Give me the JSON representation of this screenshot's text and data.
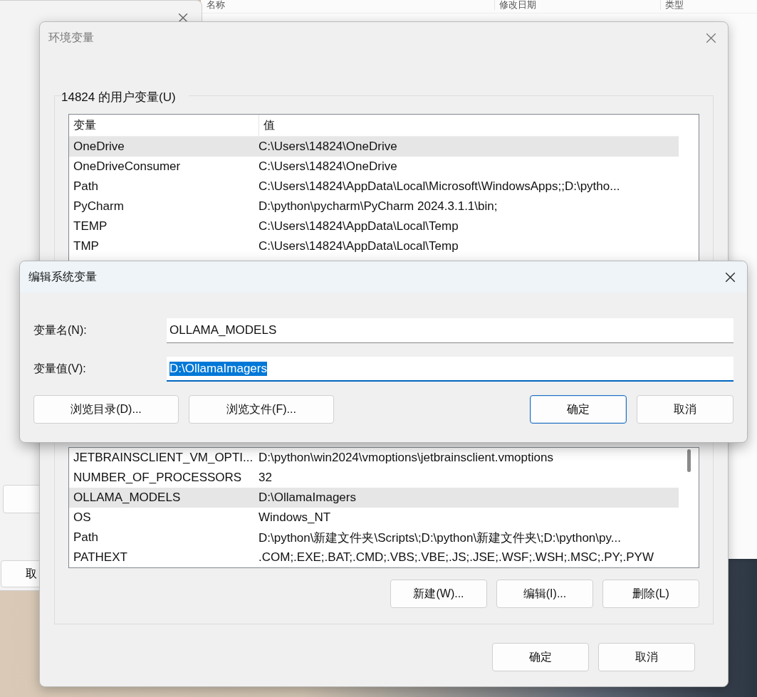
{
  "background": {
    "explorer_columns": [
      "名称",
      "修改日期",
      "类型"
    ],
    "left_window_button": "取"
  },
  "env_dialog": {
    "title": "环境变量",
    "user_group": {
      "label": "14824 的用户变量(U)",
      "columns": [
        "变量",
        "值"
      ],
      "rows": [
        {
          "name": "OneDrive",
          "value": "C:\\Users\\14824\\OneDrive",
          "selected": true
        },
        {
          "name": "OneDriveConsumer",
          "value": "C:\\Users\\14824\\OneDrive",
          "selected": false
        },
        {
          "name": "Path",
          "value": "C:\\Users\\14824\\AppData\\Local\\Microsoft\\WindowsApps;;D:\\pytho...",
          "selected": false
        },
        {
          "name": "PyCharm",
          "value": "D:\\python\\pycharm\\PyCharm 2024.3.1.1\\bin;",
          "selected": false
        },
        {
          "name": "TEMP",
          "value": "C:\\Users\\14824\\AppData\\Local\\Temp",
          "selected": false
        },
        {
          "name": "TMP",
          "value": "C:\\Users\\14824\\AppData\\Local\\Temp",
          "selected": false
        }
      ]
    },
    "system_rows": [
      {
        "name": "JETBRAINSCLIENT_VM_OPTI...",
        "value": "D:\\python\\win2024\\vmoptions\\jetbrainsclient.vmoptions",
        "selected": false
      },
      {
        "name": "NUMBER_OF_PROCESSORS",
        "value": "32",
        "selected": false
      },
      {
        "name": "OLLAMA_MODELS",
        "value": "D:\\OllamaImagers",
        "selected": true
      },
      {
        "name": "OS",
        "value": "Windows_NT",
        "selected": false
      },
      {
        "name": "Path",
        "value": "D:\\python\\新建文件夹\\Scripts\\;D:\\python\\新建文件夹\\;D:\\python\\py...",
        "selected": false
      },
      {
        "name": "PATHEXT",
        "value": ".COM;.EXE;.BAT;.CMD;.VBS;.VBE;.JS;.JSE;.WSF;.WSH;.MSC;.PY;.PYW",
        "selected": false
      }
    ],
    "system_buttons": [
      "新建(W)...",
      "编辑(I)...",
      "删除(L)"
    ],
    "buttons": [
      {
        "label": "确定",
        "default": false
      },
      {
        "label": "取消",
        "default": false
      }
    ]
  },
  "edit_dialog": {
    "title": "编辑系统变量",
    "fields": [
      {
        "label": "变量名(N):",
        "value": "OLLAMA_MODELS",
        "focused": false
      },
      {
        "label": "变量值(V):",
        "value": "D:\\OllamaImagers",
        "focused": true
      }
    ],
    "left_buttons": [
      "浏览目录(D)...",
      "浏览文件(F)..."
    ],
    "buttons": [
      {
        "label": "确定",
        "default": true
      },
      {
        "label": "取消",
        "default": false
      }
    ]
  }
}
